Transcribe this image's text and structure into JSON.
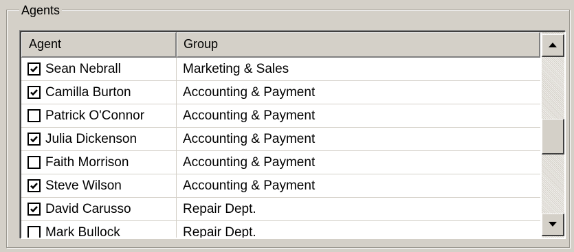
{
  "groupbox": {
    "title": "Agents"
  },
  "listview": {
    "columns": {
      "agent": "Agent",
      "group": "Group"
    },
    "rows": [
      {
        "name": "Sean Nebrall",
        "group": "Marketing & Sales",
        "checked": true
      },
      {
        "name": "Camilla Burton",
        "group": "Accounting & Payment",
        "checked": true
      },
      {
        "name": "Patrick O'Connor",
        "group": "Accounting & Payment",
        "checked": false
      },
      {
        "name": "Julia Dickenson",
        "group": "Accounting & Payment",
        "checked": true
      },
      {
        "name": "Faith Morrison",
        "group": "Accounting & Payment",
        "checked": false
      },
      {
        "name": "Steve Wilson",
        "group": "Accounting & Payment",
        "checked": true
      },
      {
        "name": "David Carusso",
        "group": "Repair Dept.",
        "checked": true
      },
      {
        "name": "Mark Bullock",
        "group": "Repair Dept.",
        "checked": false
      }
    ]
  },
  "scrollbar": {
    "up_icon": "arrow-up-icon",
    "down_icon": "arrow-down-icon",
    "position": 0.5
  }
}
